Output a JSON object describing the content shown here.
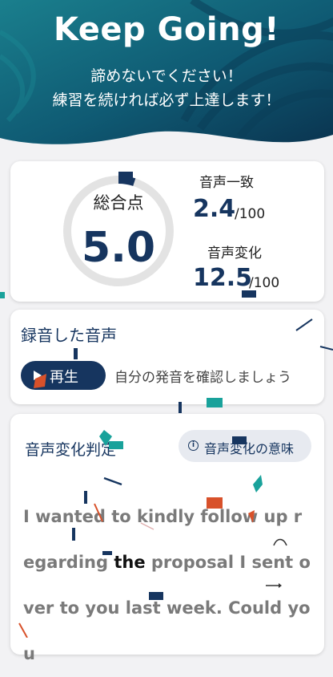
{
  "hero": {
    "title": "Keep Going!",
    "subtitle_line1": "諦めないでください！",
    "subtitle_line2": "練習を続ければ必ず上達します！"
  },
  "score": {
    "label": "総合点",
    "value": "5.0",
    "ring_fraction": 0.05,
    "accent": "#16355f",
    "track": "#e3e3e3"
  },
  "metrics": [
    {
      "label": "音声一致",
      "value": "2.4",
      "max": "/100"
    },
    {
      "label": "音声変化",
      "value": "12.5",
      "max": "/100"
    }
  ],
  "recording": {
    "title": "録音した音声",
    "play_label": "再生",
    "hint": "自分の発音を確認しましょう"
  },
  "judgement": {
    "title": "音声変化判定",
    "meaning_label": "音声変化の意味",
    "info_icon": "i",
    "sentence_before": "I wanted to kindly follow up regarding ",
    "sentence_highlight": "the",
    "sentence_after": " proposal I sent over to you last week. Could you"
  },
  "colors": {
    "hero_dark": "#0c3a52",
    "hero_teal": "#17808c",
    "navy": "#16355f",
    "confetti_orange": "#d8512a",
    "confetti_teal": "#19a29b"
  }
}
